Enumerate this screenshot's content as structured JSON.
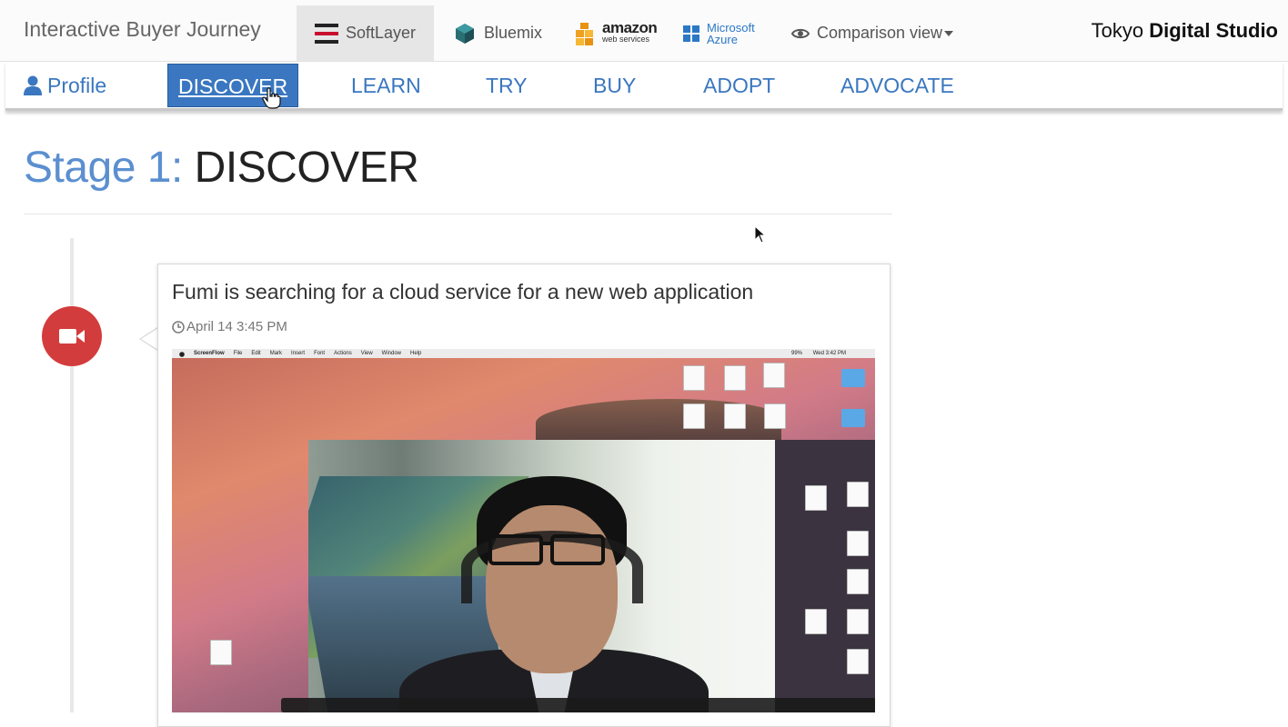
{
  "header": {
    "app_title": "Interactive Buyer Journey",
    "vendors": [
      {
        "name": "SoftLayer",
        "icon": "softlayer-logo-icon",
        "active": true
      },
      {
        "name": "Bluemix",
        "icon": "bluemix-logo-icon",
        "active": false
      },
      {
        "name_line1": "amazon",
        "name_line2": "web services",
        "icon": "aws-logo-icon",
        "active": false
      },
      {
        "name_line1": "Microsoft",
        "name_line2": "Azure",
        "icon": "windows-logo-icon",
        "active": false
      }
    ],
    "comparison_label": "Comparison view",
    "studio_prefix": "Tokyo",
    "studio_name": "Digital Studio"
  },
  "stage_nav": {
    "profile_label": "Profile",
    "stages": [
      {
        "label": "DISCOVER",
        "active": true
      },
      {
        "label": "LEARN",
        "active": false
      },
      {
        "label": "TRY",
        "active": false
      },
      {
        "label": "BUY",
        "active": false
      },
      {
        "label": "ADOPT",
        "active": false
      },
      {
        "label": "ADVOCATE",
        "active": false
      }
    ]
  },
  "stage": {
    "prefix": "Stage 1:",
    "name": "DISCOVER"
  },
  "event": {
    "icon": "video-camera-icon",
    "title": "Fumi is searching for a cloud service for a new web application",
    "timestamp": "April 14 3:45 PM"
  },
  "video": {
    "menubar_items": [
      "ScreenFlow",
      "File",
      "Edit",
      "Mark",
      "Insert",
      "Font",
      "Actions",
      "View",
      "Window",
      "Help"
    ],
    "clock": "Wed 3:42 PM",
    "battery": "99%"
  },
  "colors": {
    "accent": "#3a77c0",
    "stage_number": "#5b8fd0",
    "event_badge": "#d33c3c"
  }
}
